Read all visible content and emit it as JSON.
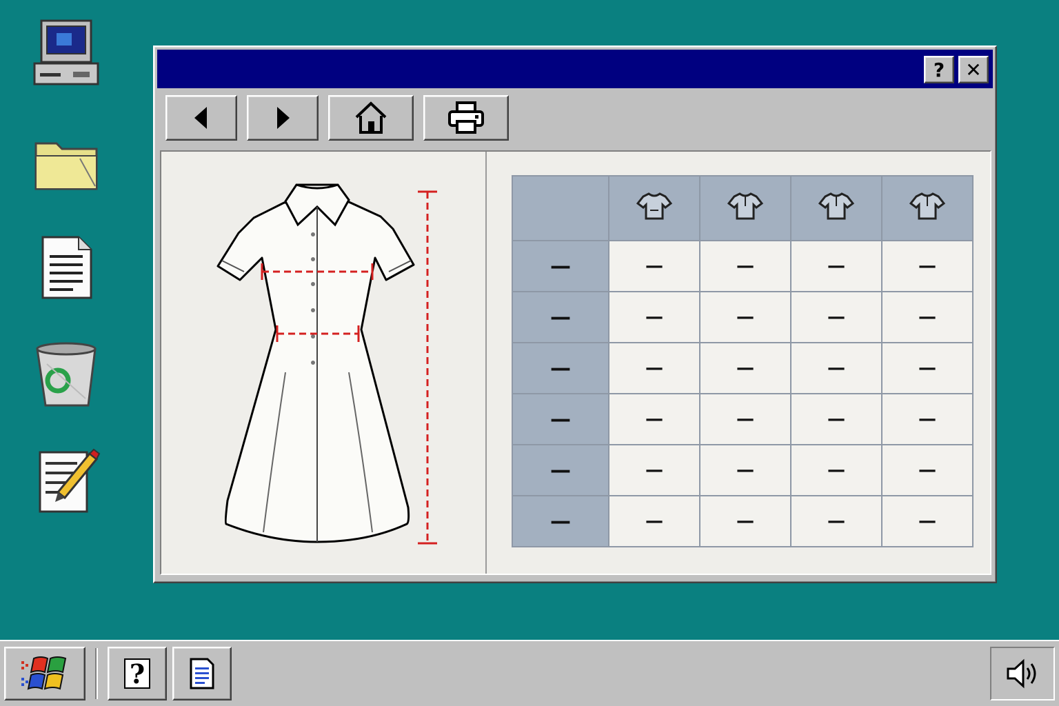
{
  "desktop": {
    "icons": [
      {
        "name": "my-computer-icon"
      },
      {
        "name": "folder-icon"
      },
      {
        "name": "document-icon"
      },
      {
        "name": "recycle-bin-icon"
      },
      {
        "name": "notepad-icon"
      }
    ]
  },
  "window": {
    "title": "",
    "title_buttons": {
      "help": "?",
      "close": "✕"
    },
    "toolbar": [
      "back",
      "forward",
      "home",
      "print"
    ]
  },
  "size_table": {
    "header_label": "",
    "columns": [
      "",
      "",
      "",
      ""
    ],
    "rows": [
      {
        "label": "—",
        "values": [
          "—",
          "—",
          "—",
          "—"
        ]
      },
      {
        "label": "—",
        "values": [
          "—",
          "—",
          "—",
          "—"
        ]
      },
      {
        "label": "—",
        "values": [
          "—",
          "—",
          "—",
          "—"
        ]
      },
      {
        "label": "—",
        "values": [
          "—",
          "—",
          "—",
          "—"
        ]
      },
      {
        "label": "—",
        "values": [
          "—",
          "—",
          "—",
          "—"
        ]
      },
      {
        "label": "—",
        "values": [
          "—",
          "—",
          "—",
          "—"
        ]
      }
    ]
  },
  "taskbar": {
    "help_label": "?"
  },
  "colors": {
    "desktop": "#0a8080",
    "titlebar": "#000080",
    "table_header": "#a3b0c0",
    "measure_line": "#d42020"
  }
}
